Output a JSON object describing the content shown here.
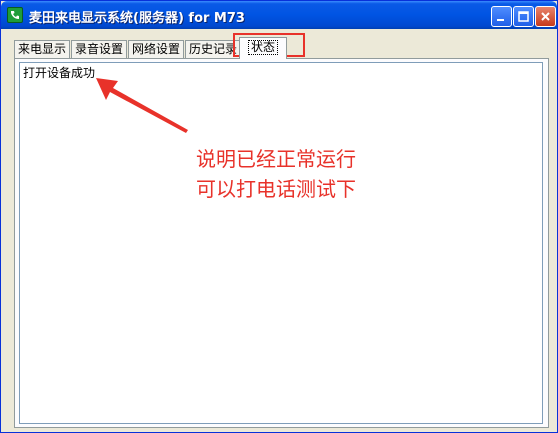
{
  "window": {
    "title": "麦田来电显示系统(服务器) for M73",
    "accent": "#0054E3"
  },
  "tabs": [
    {
      "label": "来电显示"
    },
    {
      "label": "录音设置"
    },
    {
      "label": "网络设置"
    },
    {
      "label": "历史记录"
    },
    {
      "label": "状态",
      "active": true
    }
  ],
  "status": {
    "message": "打开设备成功"
  },
  "annotation": {
    "line1": "说明已经正常运行",
    "line2": "可以打电话测试下",
    "color": "#E8322A"
  }
}
